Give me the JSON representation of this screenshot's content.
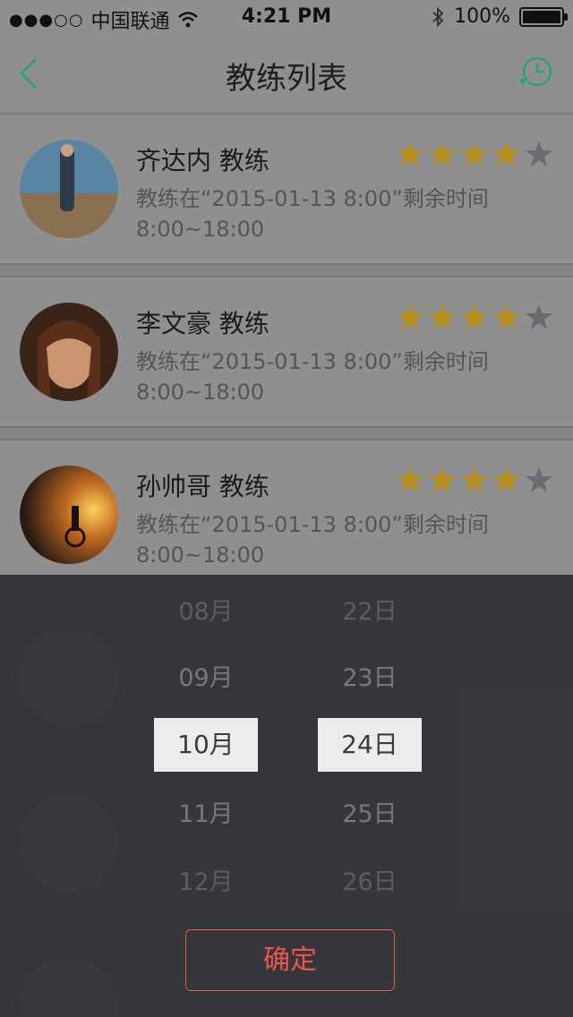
{
  "status_bar": {
    "signal": "●●●○○",
    "carrier": "中国联通",
    "time": "4:21 PM",
    "battery_text": "100%",
    "battery_level": 1.0
  },
  "nav": {
    "title": "教练列表",
    "back_icon": "chevron-left-icon",
    "history_icon": "clock-history-icon",
    "accent_color": "#2aa07a"
  },
  "coaches": [
    {
      "name": "齐达内 教练",
      "remark": "教练在“2015-01-13 8:00”剩余时间",
      "hours": "8:00~18:00",
      "rating": 4,
      "max_rating": 5
    },
    {
      "name": "李文豪 教练",
      "remark": "教练在“2015-01-13 8:00”剩余时间",
      "hours": "8:00~18:00",
      "rating": 4,
      "max_rating": 5
    },
    {
      "name": "孙帅哥 教练",
      "remark": "教练在“2015-01-13 8:00”剩余时间",
      "hours": "8:00~18:00",
      "rating": 4,
      "max_rating": 5
    }
  ],
  "picker": {
    "months": [
      "08月",
      "09月",
      "10月",
      "11月",
      "12月"
    ],
    "days": [
      "22日",
      "23日",
      "24日",
      "25日",
      "26日"
    ],
    "selected_month": "10月",
    "selected_day": "24日",
    "confirm_label": "确定"
  },
  "colors": {
    "star_filled": "#b8901a",
    "star_empty": "#6a6a70",
    "confirm": "#e9574a"
  }
}
